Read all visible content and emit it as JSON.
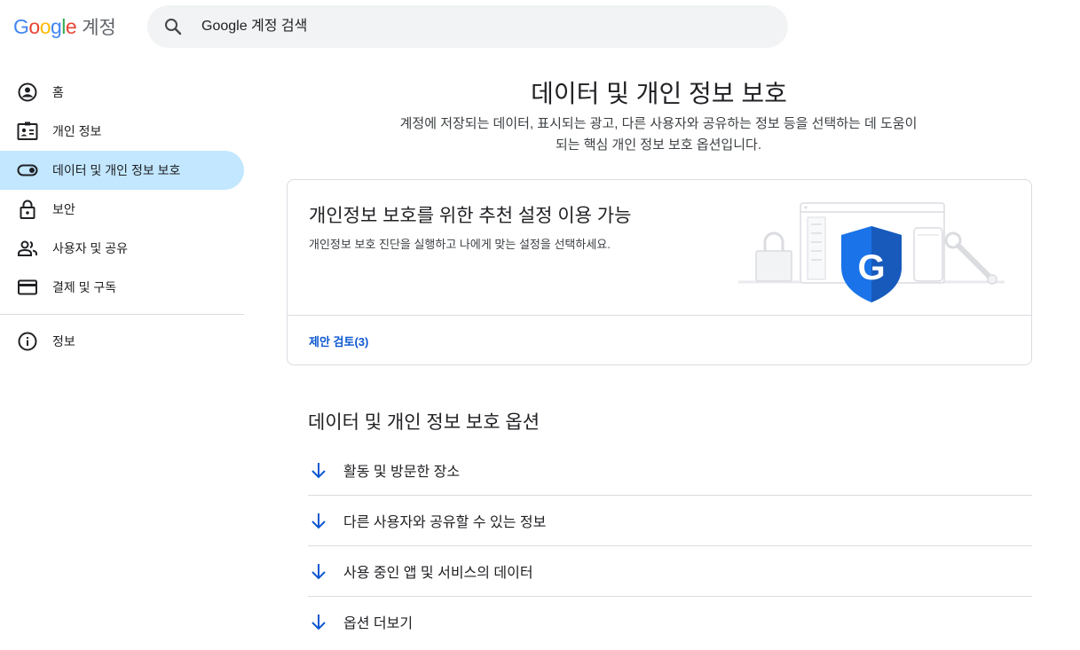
{
  "header": {
    "logo_google": "Google",
    "logo_product": "계정",
    "search_placeholder": "Google 계정 검색"
  },
  "sidebar": {
    "items": [
      {
        "label": "홈",
        "icon": "home-account-icon",
        "active": false
      },
      {
        "label": "개인 정보",
        "icon": "id-card-icon",
        "active": false
      },
      {
        "label": "데이터 및 개인 정보 보호",
        "icon": "toggle-icon",
        "active": true
      },
      {
        "label": "보안",
        "icon": "lock-icon",
        "active": false
      },
      {
        "label": "사용자 및 공유",
        "icon": "people-icon",
        "active": false
      },
      {
        "label": "결제 및 구독",
        "icon": "credit-card-icon",
        "active": false
      }
    ],
    "footer_items": [
      {
        "label": "정보",
        "icon": "info-icon"
      }
    ]
  },
  "main": {
    "title": "데이터 및 개인 정보 보호",
    "subtitle": "계정에 저장되는 데이터, 표시되는 광고, 다른 사용자와 공유하는 정보 등을 선택하는 데 도움이 되는 핵심 개인 정보 보호 옵션입니다.",
    "card": {
      "title": "개인정보 보호를 위한 추천 설정 이용 가능",
      "description": "개인정보 보호 진단을 실행하고 나에게 맞는 설정을 선택하세요.",
      "link": "제안 검토(3)",
      "illustration": "privacy-shield-illustration"
    },
    "section_title": "데이터 및 개인 정보 보호 옵션",
    "options": [
      {
        "label": "활동 및 방문한 장소"
      },
      {
        "label": "다른 사용자와 공유할 수 있는 정보"
      },
      {
        "label": "사용 중인 앱 및 서비스의 데이터"
      },
      {
        "label": "옵션 더보기"
      }
    ]
  },
  "colors": {
    "accent": "#0b57d0",
    "active_nav_bg": "#c2e7ff",
    "search_bg": "#f1f3f4",
    "divider": "#dadce0"
  }
}
